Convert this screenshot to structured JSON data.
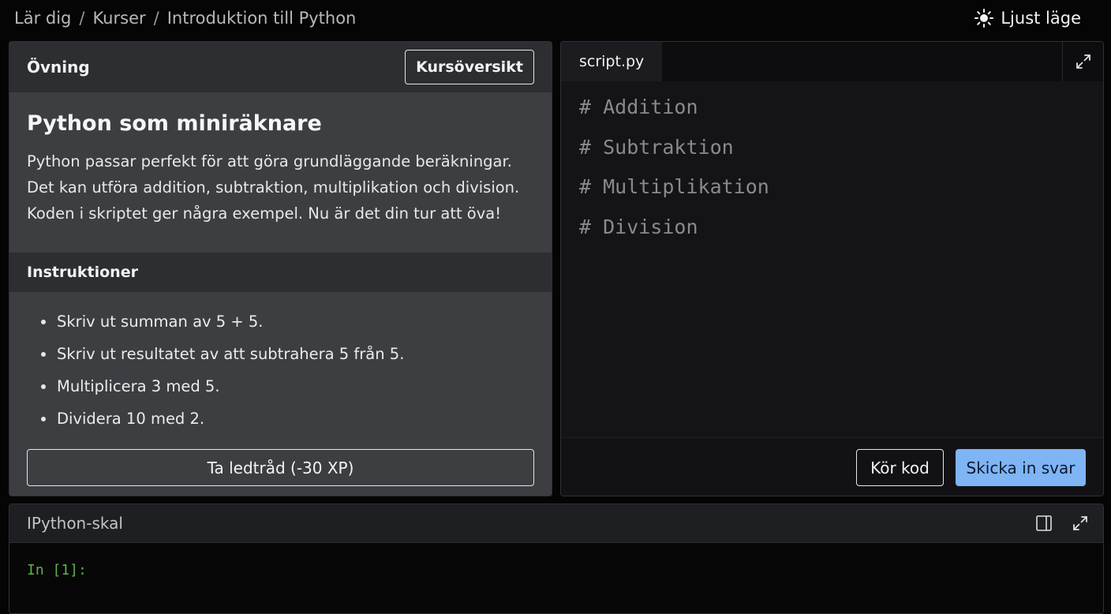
{
  "breadcrumb": {
    "items": [
      "Lär dig",
      "Kurser",
      "Introduktion till Python"
    ],
    "separator": "/"
  },
  "theme_toggle": {
    "label": "Ljust läge",
    "icon": "sun-icon"
  },
  "exercise": {
    "header_label": "Övning",
    "overview_button": "Kursöversikt",
    "title": "Python som miniräknare",
    "text": "Python passar perfekt för att göra grundläggande beräkningar. Det kan utföra addition, subtraktion, multiplikation och division. Koden i skriptet ger några exempel. Nu är det din tur att öva!",
    "instructions_label": "Instruktioner",
    "instructions": [
      "Skriv ut summan av 5 + 5.",
      "Skriv ut resultatet av att subtrahera 5 från 5.",
      "Multiplicera 3 med 5.",
      "Dividera 10 med 2."
    ],
    "hint_button": "Ta ledtråd (-30 XP)"
  },
  "editor": {
    "tab_label": "script.py",
    "code_lines": [
      "# Addition",
      "# Subtraktion",
      "# Multiplikation",
      "# Division"
    ],
    "run_button": "Kör kod",
    "submit_button": "Skicka in svar"
  },
  "shell": {
    "title": "IPython-skal",
    "prompt": "In [1]:"
  },
  "colors": {
    "background": "#050505",
    "panel": "#3c3e42",
    "panel_header": "#2c2e31",
    "editor_bg": "#141418",
    "code_comment": "#8a8a8e",
    "submit_accent": "#7fb4f5",
    "prompt_green": "#5db14f"
  }
}
